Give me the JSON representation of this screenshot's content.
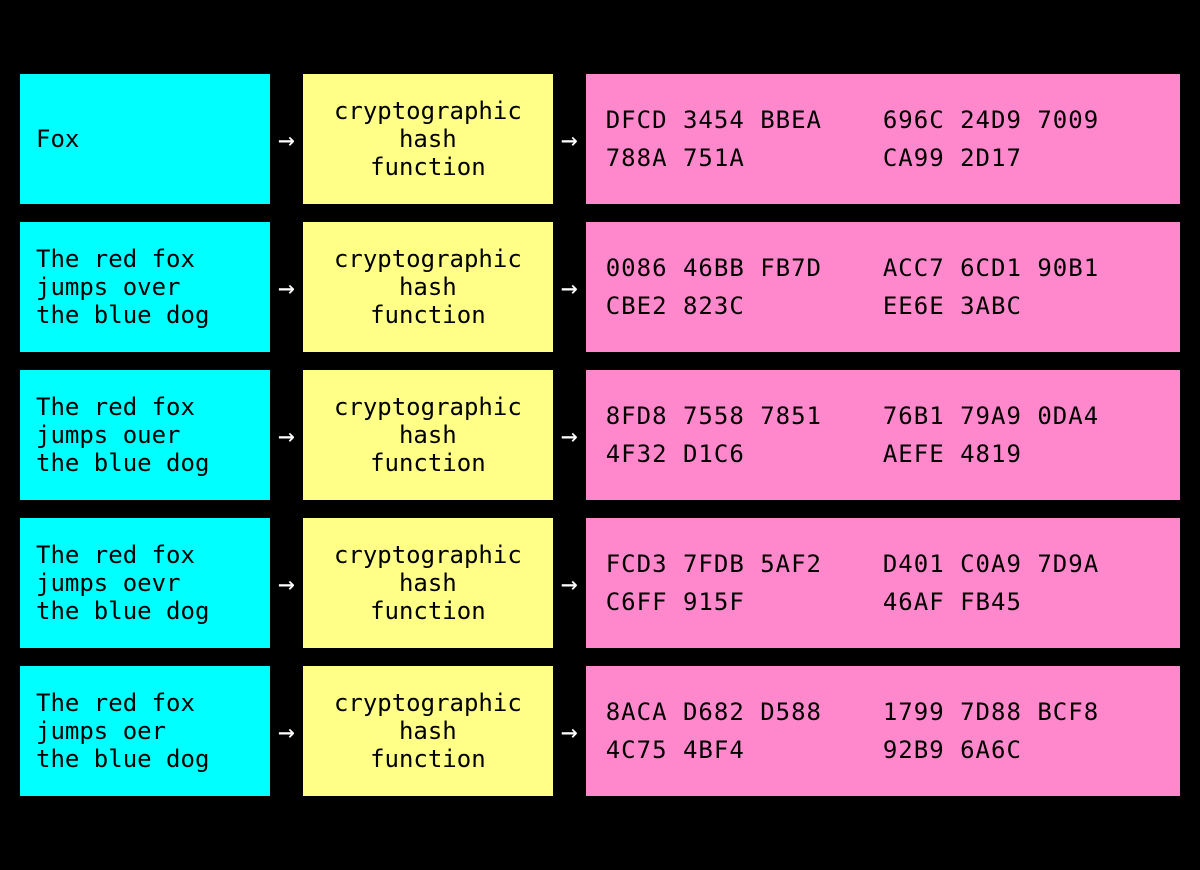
{
  "rows": [
    {
      "id": "row-1",
      "input": "Fox",
      "hash_function": "cryptographic\nhash\nfunction",
      "output_line1": "DFCD  3454  BBEA  788A  751A",
      "output_line2": "696C  24D9  7009  CA99  2D17"
    },
    {
      "id": "row-2",
      "input": "The red fox\njumps over\nthe blue dog",
      "hash_function": "cryptographic\nhash\nfunction",
      "output_line1": "0086  46BB  FB7D  CBE2  823C",
      "output_line2": "ACC7  6CD1  90B1  EE6E  3ABC"
    },
    {
      "id": "row-3",
      "input": "The red fox\njumps ouer\nthe blue dog",
      "hash_function": "cryptographic\nhash\nfunction",
      "output_line1": "8FD8  7558  7851  4F32  D1C6",
      "output_line2": "76B1  79A9  0DA4  AEFE  4819"
    },
    {
      "id": "row-4",
      "input": "The red fox\njumps oevr\nthe blue dog",
      "hash_function": "cryptographic\nhash\nfunction",
      "output_line1": "FCD3  7FDB  5AF2  C6FF  915F",
      "output_line2": "D401  C0A9  7D9A  46AF  FB45"
    },
    {
      "id": "row-5",
      "input": "The red fox\njumps oer\nthe blue dog",
      "hash_function": "cryptographic\nhash\nfunction",
      "output_line1": "8ACA  D682  D588  4C75  4BF4",
      "output_line2": "1799  7D88  BCF8  92B9  6A6C"
    }
  ],
  "arrow_symbol": "→"
}
